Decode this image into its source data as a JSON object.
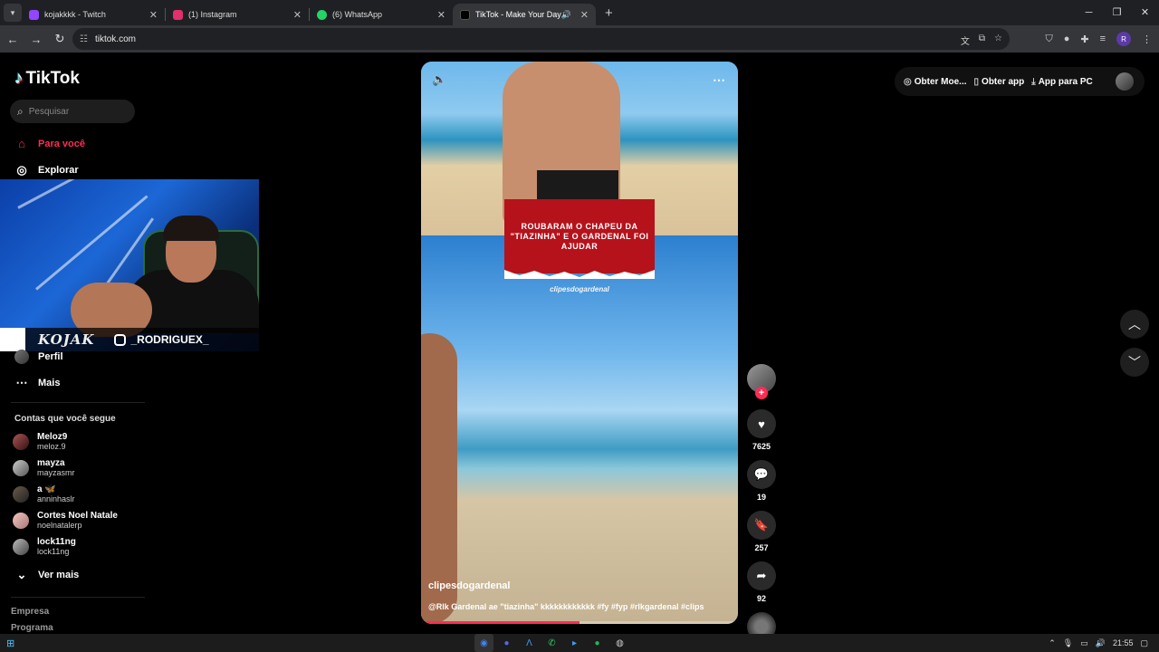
{
  "browser": {
    "tabs": [
      {
        "title": "kojakkkk - Twitch",
        "color": "#9146ff",
        "active": false
      },
      {
        "title": "(1) Instagram",
        "color": "#e1306c",
        "active": false
      },
      {
        "title": "(6) WhatsApp",
        "color": "#25d366",
        "active": false
      },
      {
        "title": "TikTok - Make Your Day",
        "color": "#000000",
        "active": true
      }
    ],
    "url": "tiktok.com",
    "profile_initial": "R"
  },
  "sidebar": {
    "logo": "TikTok",
    "search_placeholder": "Pesquisar",
    "nav": {
      "for_you": "Para você",
      "explore": "Explorar",
      "profile": "Perfil",
      "more": "Mais"
    },
    "following_header": "Contas que você segue",
    "following": [
      {
        "name": "Meloz9",
        "user": "meloz.9"
      },
      {
        "name": "mayza",
        "user": "mayzasmr"
      },
      {
        "name": "a 🦋",
        "user": "anninhaslr"
      },
      {
        "name": "Cortes Noel Natale",
        "user": "noelnatalerp"
      },
      {
        "name": "lock11ng",
        "user": "lock11ng"
      }
    ],
    "see_more": "Ver mais",
    "footer": [
      "Empresa",
      "Programa"
    ]
  },
  "webcam": {
    "tag": "KOJAK",
    "instagram": "_RODRIGUEX_"
  },
  "video": {
    "title_overlay": "ROUBARAM O CHAPEU DA \"TIAZINHA\" E O GARDENAL FOI AJUDAR",
    "watermark": "clipesdogardenal",
    "author": "clipesdogardenal",
    "caption": "@Rlk Gardenal ae \"tiazinha\" kkkkkkkkkkkk #fy #fyp #rlkgardenal #clips",
    "progress": 0.5
  },
  "actions": {
    "likes": "7625",
    "comments": "19",
    "saves": "257",
    "shares": "92"
  },
  "top_actions": {
    "coins": "Obter Moe...",
    "app": "Obter app",
    "pc": "App para PC"
  },
  "taskbar": {
    "time": "21:55"
  }
}
